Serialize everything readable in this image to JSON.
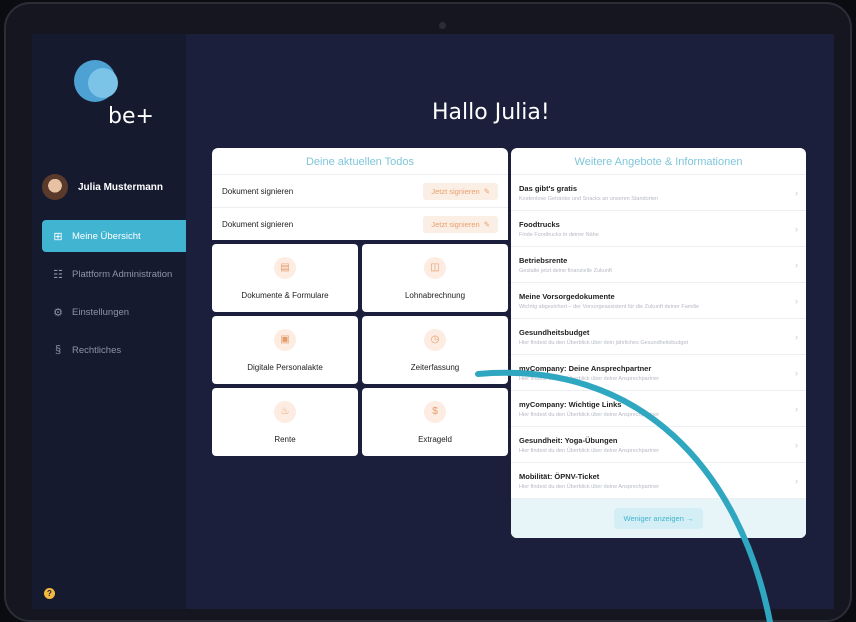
{
  "brand": {
    "logo_text": "be+"
  },
  "user": {
    "name": "Julia Mustermann"
  },
  "nav": [
    {
      "label": "Meine Übersicht",
      "icon": "grid-icon",
      "active": true
    },
    {
      "label": "Plattform Administration",
      "icon": "admin-icon",
      "active": false
    },
    {
      "label": "Einstellungen",
      "icon": "gear-icon",
      "active": false
    },
    {
      "label": "Rechtliches",
      "icon": "paragraph-icon",
      "active": false
    }
  ],
  "help": {
    "label": "?"
  },
  "greeting": "Hallo Julia!",
  "todos": {
    "title": "Deine aktuellen Todos",
    "items": [
      {
        "label": "Dokument signieren",
        "action": "Jetzt signieren"
      },
      {
        "label": "Dokument signieren",
        "action": "Jetzt signieren"
      }
    ]
  },
  "tiles": [
    {
      "label": "Dokumente & Formulare",
      "icon": "document-icon"
    },
    {
      "label": "Lohnabrechnung",
      "icon": "wallet-icon"
    },
    {
      "label": "Digitale Personalakte",
      "icon": "file-icon"
    },
    {
      "label": "Zeiterfassung",
      "icon": "stopwatch-icon"
    },
    {
      "label": "Rente",
      "icon": "pension-icon"
    },
    {
      "label": "Extrageld",
      "icon": "money-icon"
    }
  ],
  "offers": {
    "title": "Weitere Angebote & Informationen",
    "items": [
      {
        "title": "Das gibt's gratis",
        "subtitle": "Kostenlose Getränke und Snacks an unseren Standorten"
      },
      {
        "title": "Foodtrucks",
        "subtitle": "Finde Foodtrucks in deiner Nähe"
      },
      {
        "title": "Betriebsrente",
        "subtitle": "Gestalte jetzt deine finanzielle Zukunft"
      },
      {
        "title": "Meine Vorsorgedokumente",
        "subtitle": "Wichtig abgesichert – der Vorsorgeassistent für die Zukunft deiner Familie"
      },
      {
        "title": "Gesundheitsbudget",
        "subtitle": "Hier findest du den Überblick über dein jährliches Gesundheitsbudget"
      },
      {
        "title": "myCompany: Deine Ansprechpartner",
        "subtitle": "Hier findest du den Überblick über deine Ansprechpartner"
      },
      {
        "title": "myCompany: Wichtige Links",
        "subtitle": "Hier findest du den Überblick über deine Ansprechpartner"
      },
      {
        "title": "Gesundheit: Yoga-Übungen",
        "subtitle": "Hier findest du den Überblick über deine Ansprechpartner"
      },
      {
        "title": "Mobilität: ÖPNV-Ticket",
        "subtitle": "Hier findest du den Überblick über deine Ansprechpartner"
      }
    ],
    "show_less": "Weniger anzeigen →"
  },
  "colors": {
    "accent": "#41b4d1",
    "background": "#1b1f3b",
    "sidebar": "#161a2e",
    "action": "#e9a06e"
  }
}
